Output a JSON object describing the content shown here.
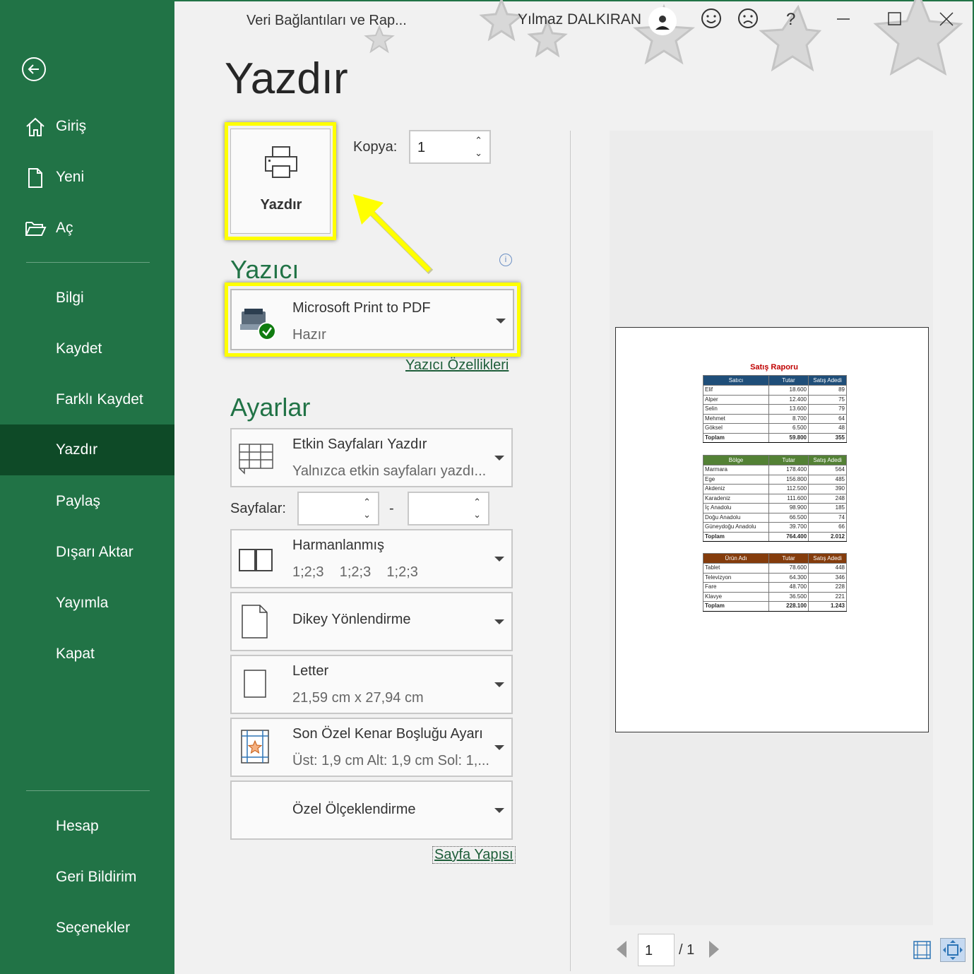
{
  "window": {
    "title": "Veri Bağlantıları ve Rap...",
    "user": "Yılmaz DALKIRAN",
    "help": "?"
  },
  "sidebar": {
    "top_items": [
      {
        "label": "Giriş",
        "icon": "home-icon"
      },
      {
        "label": "Yeni",
        "icon": "new-document-icon"
      },
      {
        "label": "Aç",
        "icon": "open-folder-icon"
      }
    ],
    "items": [
      "Bilgi",
      "Kaydet",
      "Farklı Kaydet",
      "Yazdır",
      "Paylaş",
      "Dışarı Aktar",
      "Yayımla",
      "Kapat"
    ],
    "active": "Yazdır",
    "bottom_items": [
      "Hesap",
      "Geri Bildirim",
      "Seçenekler"
    ]
  },
  "print": {
    "page_title": "Yazdır",
    "button_label": "Yazdır",
    "copies_label": "Kopya:",
    "copies_value": "1"
  },
  "printer": {
    "section_title": "Yazıcı",
    "name": "Microsoft Print to PDF",
    "status": "Hazır",
    "properties_link": "Yazıcı Özellikleri"
  },
  "settings": {
    "section_title": "Ayarlar",
    "what_to_print": {
      "title": "Etkin Sayfaları Yazdır",
      "subtitle": "Yalnızca etkin sayfaları yazdı..."
    },
    "pages_label": "Sayfalar:",
    "pages_from": "",
    "pages_to": "",
    "pages_dash": "-",
    "collation": {
      "title": "Harmanlanmış",
      "subtitle": "1;2;3    1;2;3    1;2;3"
    },
    "orientation": {
      "title": "Dikey Yönlendirme"
    },
    "paper": {
      "title": "Letter",
      "subtitle": "21,59 cm x 27,94 cm"
    },
    "margins": {
      "title": "Son Özel Kenar Boşluğu Ayarı",
      "subtitle": "Üst: 1,9 cm Alt: 1,9 cm Sol: 1,..."
    },
    "scaling": {
      "title": "Özel Ölçeklendirme"
    },
    "page_setup_link": "Sayfa Yapısı"
  },
  "preview": {
    "report_title": "Satış Raporu",
    "tables": [
      {
        "headers": [
          "Satıcı",
          "Tutar",
          "Satış Adedi"
        ],
        "header_color": "#1f4e79",
        "rows": [
          [
            "Elif",
            "18.600",
            "89"
          ],
          [
            "Alper",
            "12.400",
            "75"
          ],
          [
            "Selin",
            "13.600",
            "79"
          ],
          [
            "Mehmet",
            "8.700",
            "64"
          ],
          [
            "Göksel",
            "6.500",
            "48"
          ]
        ],
        "total": [
          "Toplam",
          "59.800",
          "355"
        ]
      },
      {
        "headers": [
          "Bölge",
          "Tutar",
          "Satış Adedi"
        ],
        "header_color": "#538135",
        "rows": [
          [
            "Marmara",
            "178.400",
            "564"
          ],
          [
            "Ege",
            "156.800",
            "485"
          ],
          [
            "Akdeniz",
            "112.500",
            "390"
          ],
          [
            "Karadeniz",
            "111.600",
            "248"
          ],
          [
            "İç Anadolu",
            "98.900",
            "185"
          ],
          [
            "Doğu Anadolu",
            "66.500",
            "74"
          ],
          [
            "Güneydoğu Anadolu",
            "39.700",
            "66"
          ]
        ],
        "total": [
          "Toplam",
          "764.400",
          "2.012"
        ]
      },
      {
        "headers": [
          "Ürün Adı",
          "Tutar",
          "Satış Adedi"
        ],
        "header_color": "#843c0c",
        "rows": [
          [
            "Tablet",
            "78.600",
            "448"
          ],
          [
            "Televizyon",
            "64.300",
            "346"
          ],
          [
            "Fare",
            "48.700",
            "228"
          ],
          [
            "Klavye",
            "36.500",
            "221"
          ]
        ],
        "total": [
          "Toplam",
          "228.100",
          "1.243"
        ]
      }
    ],
    "current_page": "1",
    "total_pages": "/ 1"
  },
  "colors": {
    "brand": "#217346",
    "active_nav": "#0e4a27",
    "highlight": "#ffff00",
    "title_red": "#c00000"
  }
}
